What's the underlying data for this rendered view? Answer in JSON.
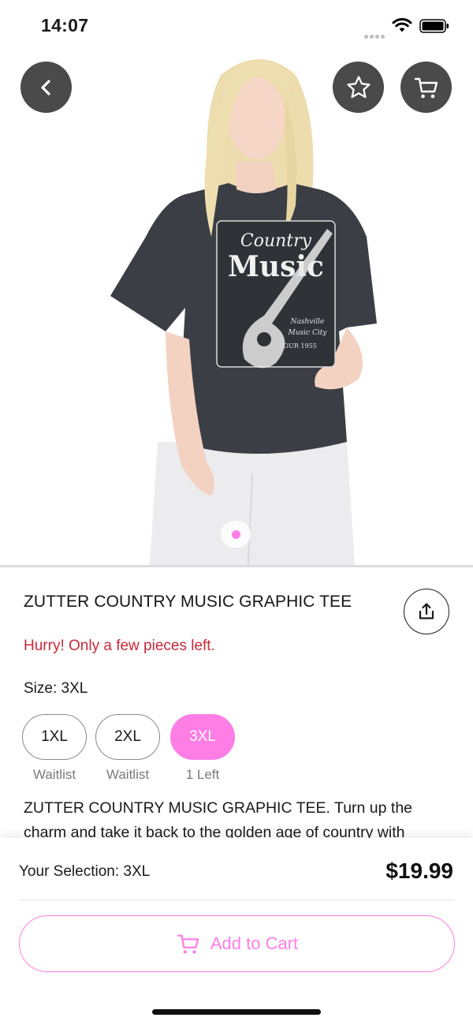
{
  "status_bar": {
    "time": "14:07"
  },
  "product": {
    "title": "ZUTTER COUNTRY MUSIC GRAPHIC TEE",
    "stock_warning": "Hurry! Only a few pieces left.",
    "size_label": "Size: 3XL",
    "sizes": [
      {
        "label": "1XL",
        "status": "Waitlist",
        "selected": false
      },
      {
        "label": "2XL",
        "status": "Waitlist",
        "selected": false
      },
      {
        "label": "3XL",
        "status": "1 Left",
        "selected": true
      }
    ],
    "description": "ZUTTER COUNTRY MUSIC GRAPHIC TEE. Turn up the charm and take it back to the golden age of country with",
    "shirt_graphic": [
      "Country",
      "Music",
      "Nashville",
      "Music City",
      "TOUR 1955"
    ]
  },
  "gallery": {
    "page_count": 1,
    "active_page": 1
  },
  "bottom_bar": {
    "selection": "Your Selection: 3XL",
    "price": "$19.99",
    "add_to_cart_label": "Add to Cart"
  },
  "colors": {
    "accent": "#ff7ee6",
    "warning": "#c8283a",
    "nav_button_bg": "#4a4a4a"
  },
  "icons": [
    "back-arrow-icon",
    "star-icon",
    "cart-icon",
    "share-icon",
    "wifi-icon",
    "battery-icon"
  ]
}
